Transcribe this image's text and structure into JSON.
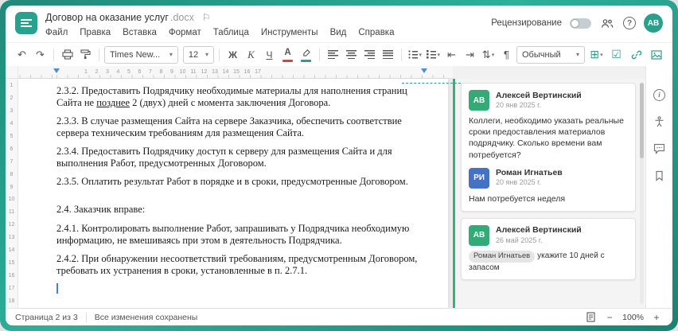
{
  "titlebar": {
    "title": "Договор на оказание услуг",
    "extension": ".docx"
  },
  "menu": [
    "Файл",
    "Правка",
    "Вставка",
    "Формат",
    "Таблица",
    "Инструменты",
    "Вид",
    "Справка"
  ],
  "topbar": {
    "review_label": "Рецензирование",
    "avatar_initials": "АВ"
  },
  "toolbar": {
    "font_name": "Times New...",
    "font_size": "12",
    "bold": "Ж",
    "italic": "К",
    "underline": "Ч",
    "color_letter": "А",
    "style_name": "Обычный"
  },
  "icons": {
    "flag": "⚐",
    "caret": "▾",
    "undo": "↶",
    "redo": "↷",
    "question": "?",
    "info": "i",
    "table": "⊞",
    "checkbox": "☑",
    "indent_decrease": "⇤",
    "indent_increase": "⇥",
    "line_spacing": "⇅",
    "nonprinting": "¶",
    "zoom_out": "−",
    "zoom_in": "+"
  },
  "rulers": {
    "horizontal": [
      "1",
      "2",
      "3",
      "4",
      "5",
      "6",
      "7",
      "8",
      "9",
      "10",
      "11",
      "12",
      "13",
      "14",
      "15",
      "16",
      "17"
    ],
    "vertical": [
      "1",
      "2",
      "3",
      "4",
      "5",
      "6",
      "7",
      "8",
      "9",
      "10",
      "11",
      "12",
      "13",
      "14",
      "15",
      "16",
      "17",
      "18"
    ]
  },
  "document": {
    "p1_before": "2.3.2. Предоставить Подрядчику необходимые материалы для наполнения страниц Сайта не ",
    "p1_inserted": "позднее",
    "p1_after": " 2 (двух) дней с момента заключения Договора.",
    "paragraphs": [
      "2.3.3. В случае размещения Сайта на сервере Заказчика, обеспечить соответствие сервера техническим требованиям для размещения Сайта.",
      "2.3.4. Предоставить Подрядчику доступ к серверу для размещения Сайта и для выполнения Работ, предусмотренных Договором.",
      "2.3.5. Оплатить результат Работ в порядке и в сроки, предусмотренные Договором.",
      "2.4. Заказчик вправе:",
      "2.4.1. Контролировать выполнение Работ, запрашивать у Подрядчика необходимую информацию, не вмешиваясь при этом в деятельность Подрядчика.",
      "2.4.2. При обнаружении несоответствий требованиям, предусмотренным Договором, требовать их устранения в сроки, установленные в п. 2.7.1."
    ]
  },
  "comments": {
    "thread1": {
      "initials": "АВ",
      "author": "Алексей Вертинский",
      "date": "20 янв 2025 г.",
      "text": "Коллеги, необходимо указать реальные сроки предоставления материалов подрядчику. Сколько времени вам потребуется?",
      "reply": {
        "initials": "РИ",
        "author": "Роман Игнатьев",
        "date": "20 янв 2025 г.",
        "text": "Нам потребуется неделя"
      }
    },
    "thread2": {
      "initials": "АВ",
      "author": "Алексей Вертинский",
      "date": "26 май 2025 г.",
      "mention": "Роман Игнатьев",
      "text": "укажите 10 дней с запасом"
    }
  },
  "statusbar": {
    "page_info": "Страница 2 из 3",
    "save_status": "Все изменения сохранены",
    "zoom": "100%"
  },
  "colors": {
    "accent": "#2aa08c",
    "avatar_green": "#33ab77",
    "avatar_blue": "#4472c4"
  }
}
